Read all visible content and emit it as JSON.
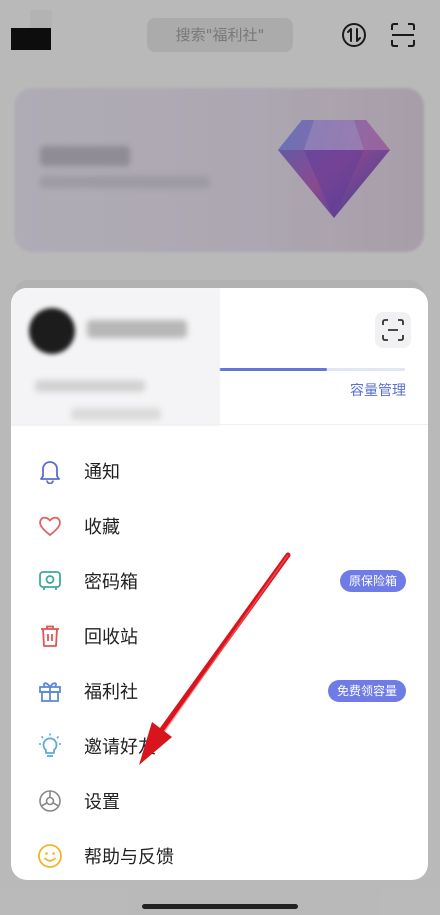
{
  "header": {
    "search_placeholder": "搜索\"福利社\""
  },
  "menu": {
    "capacity_link": "容量管理",
    "storage_progress_percent": 79,
    "items": [
      {
        "label": "通知",
        "icon": "bell-icon"
      },
      {
        "label": "收藏",
        "icon": "heart-icon"
      },
      {
        "label": "密码箱",
        "icon": "safe-box-icon",
        "badge": "原保险箱"
      },
      {
        "label": "回收站",
        "icon": "trash-icon"
      },
      {
        "label": "福利社",
        "icon": "gift-icon",
        "badge": "免费领容量"
      },
      {
        "label": "邀请好友",
        "icon": "lightbulb-icon"
      },
      {
        "label": "设置",
        "icon": "gear-icon"
      },
      {
        "label": "帮助与反馈",
        "icon": "smiley-icon"
      }
    ]
  },
  "colors": {
    "accent": "#6477d8",
    "badge": "#6f7ce6",
    "annotation_arrow": "#d8141c",
    "bell": "#5b6ed0",
    "heart": "#e06262",
    "safe": "#3fa7a3",
    "trash": "#e05454",
    "gift": "#5b8bd8",
    "bulb": "#5aa9e0",
    "gear": "#888888",
    "smiley": "#f1b427"
  }
}
